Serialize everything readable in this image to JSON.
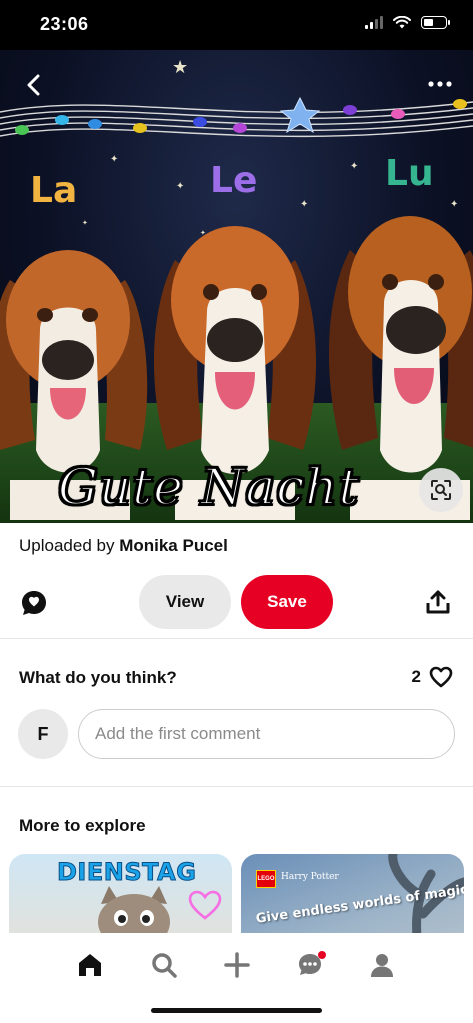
{
  "status_bar": {
    "time": "23:06"
  },
  "pin": {
    "image_caption": "Gute Nacht",
    "image_syllables": [
      "La",
      "Le",
      "Lu"
    ],
    "uploaded_prefix": "Uploaded by",
    "uploader": "Monika Pucel"
  },
  "actions": {
    "view_label": "View",
    "save_label": "Save"
  },
  "comments": {
    "title": "What do you think?",
    "like_count": "2",
    "avatar_initial": "F",
    "input_placeholder": "Add the first comment"
  },
  "explore": {
    "title": "More to explore",
    "cards": [
      {
        "text": "DIENSTAG"
      },
      {
        "brand": "LEGO",
        "brand_sub": "Harry Potter",
        "tagline": "Give endless worlds of magic"
      }
    ]
  },
  "nav": {
    "items": [
      "home-icon",
      "search-icon",
      "plus-icon",
      "messages-icon",
      "profile-icon"
    ],
    "notification_color": "#e60023"
  },
  "colors": {
    "accent": "#e60023",
    "button_gray": "#e9e9e9"
  }
}
